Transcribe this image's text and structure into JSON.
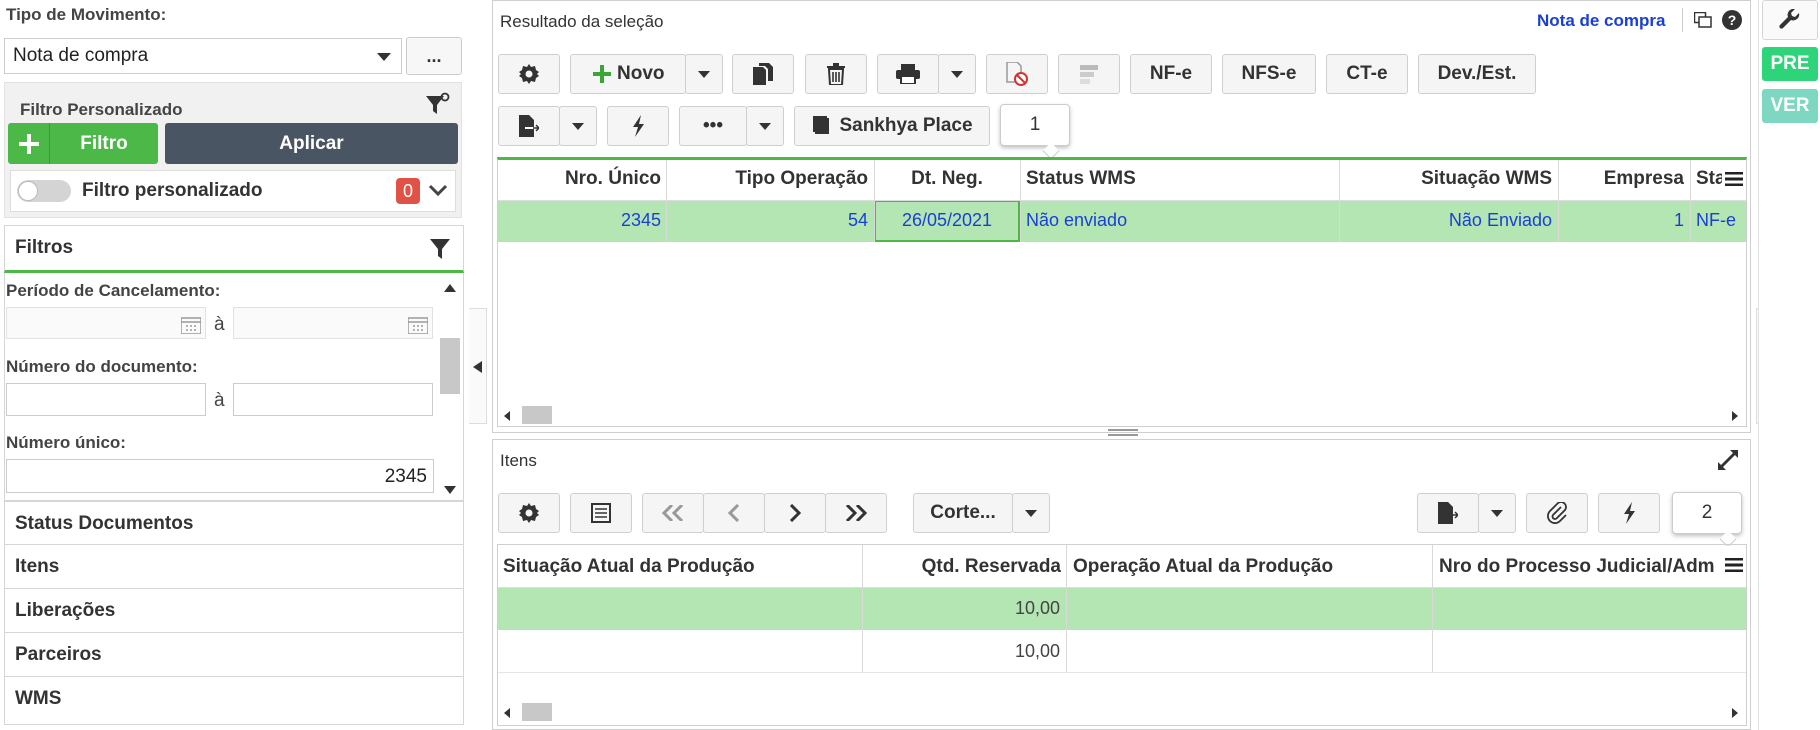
{
  "tipo_movimento": {
    "label": "Tipo de Movimento:",
    "value": "Nota de compra",
    "more_label": "..."
  },
  "filtro_personalizado": {
    "title": "Filtro Personalizado",
    "add_label": "Filtro",
    "apply_label": "Aplicar",
    "toggle_label": "Filtro personalizado",
    "count": "0"
  },
  "filtros": {
    "title": "Filtros",
    "periodo_label": "Período de Cancelamento:",
    "separator": "à",
    "numero_documento_label": "Número do documento:",
    "numero_unico_label": "Número único:",
    "numero_unico_value": "2345"
  },
  "sections": [
    "Status Documentos",
    "Itens",
    "Liberações",
    "Parceiros",
    "WMS"
  ],
  "resultado": {
    "title": "Resultado da seleção",
    "link": "Nota de compra",
    "toolbar": {
      "novo": "Novo",
      "nfe": "NF-e",
      "nfse": "NFS-e",
      "cte": "CT-e",
      "dev": "Dev./Est.",
      "more": "•••",
      "sankhya": "Sankhya Place",
      "badge": "1"
    },
    "columns": [
      "Nro. Único",
      "Tipo Operação",
      "Dt. Neg.",
      "Status WMS",
      "Situação WMS",
      "Empresa",
      "Sta"
    ],
    "row": [
      "2345",
      "54",
      "26/05/2021",
      "Não enviado",
      "Não Enviado",
      "1",
      "NF-e"
    ]
  },
  "itens": {
    "title": "Itens",
    "corte_label": "Corte...",
    "badge": "2",
    "columns": [
      "Situação Atual da Produção",
      "Qtd. Reservada",
      "Operação Atual da Produção",
      "Nro do Processo Judicial/Adm"
    ],
    "rows": [
      [
        "",
        "10,00",
        "",
        ""
      ],
      [
        "",
        "10,00",
        "",
        ""
      ]
    ]
  },
  "right_rail": {
    "pre": "PRE",
    "ver": "VER"
  },
  "colors": {
    "green": "#4cb848",
    "dark": "#4a5563",
    "selected_row": "#b4e6b4",
    "link_blue": "#1a3fd6",
    "pre_green": "#2ed47a",
    "ver_teal": "#7ed8c1",
    "badge_red": "#e05245"
  }
}
